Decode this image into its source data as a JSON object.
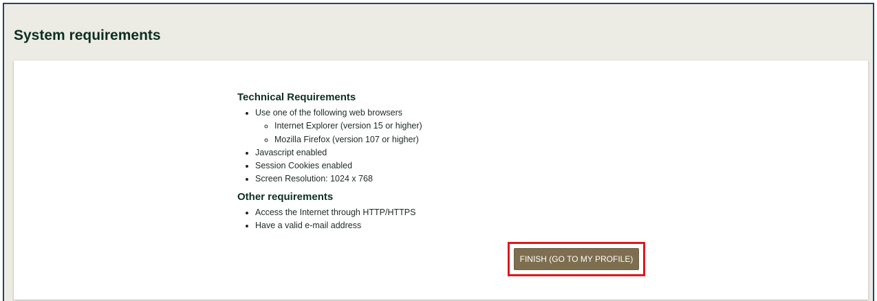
{
  "page": {
    "title": "System requirements"
  },
  "technical": {
    "heading": "Technical Requirements",
    "items": [
      "Use one of the following web browsers",
      "Javascript enabled",
      "Session Cookies enabled",
      "Screen Resolution: 1024 x 768"
    ],
    "browsers": [
      "Internet Explorer (version 15 or higher)",
      "Mozilla Firefox (version 107 or higher)"
    ]
  },
  "other": {
    "heading": "Other requirements",
    "items": [
      "Access the Internet through HTTP/HTTPS",
      "Have a valid e-mail address"
    ]
  },
  "actions": {
    "finish_label": "FINISH (GO TO MY PROFILE)"
  },
  "colors": {
    "header_background": "#ecebe4",
    "frame_border": "#20446a",
    "title_text": "#0c2f22",
    "button_background": "#7d6e4f",
    "highlight_border": "#e0161b"
  }
}
